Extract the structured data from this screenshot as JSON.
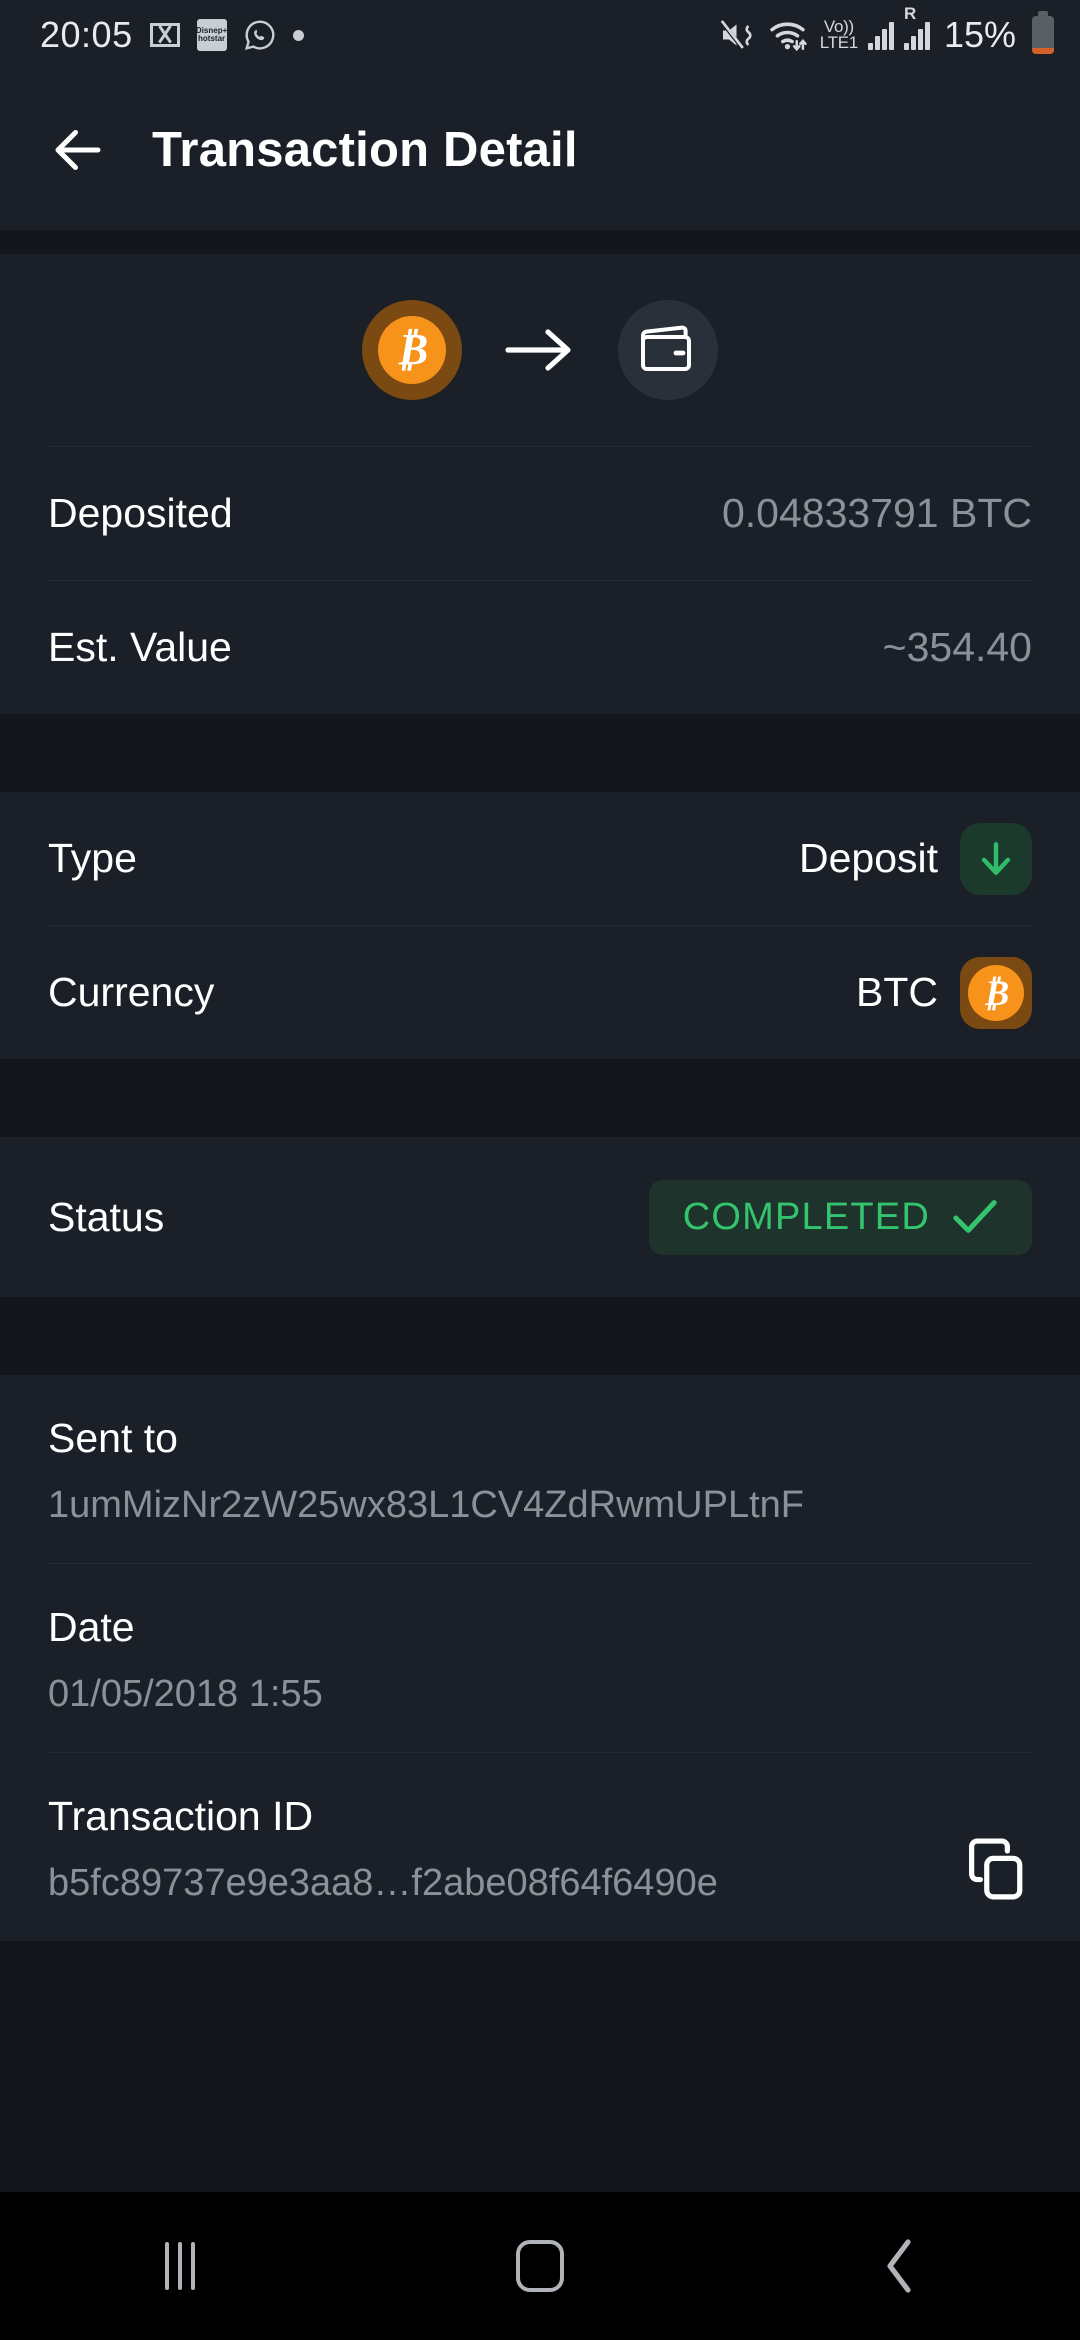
{
  "status_bar": {
    "time": "20:05",
    "icons_left": [
      "gmail-icon",
      "hotstar-icon",
      "whatsapp-icon",
      "dot-icon"
    ],
    "hotstar_line1": "Disnep+",
    "hotstar_line2": "hotstar",
    "icons_right": [
      "mute-vibrate-icon",
      "wifi-icon",
      "volte-icon",
      "signal-icon",
      "roaming-signal-icon"
    ],
    "volte_top": "Vo))",
    "volte_bottom": "LTE1",
    "roaming_letter": "R",
    "battery_percent": "15%"
  },
  "header": {
    "back_label": "back-arrow",
    "title": "Transaction Detail"
  },
  "transfer": {
    "from_icon": "bitcoin-icon",
    "from_symbol": "₿",
    "arrow_icon": "arrow-right-icon",
    "to_icon": "wallet-icon"
  },
  "amounts": [
    {
      "label": "Deposited",
      "value": "0.04833791 BTC"
    },
    {
      "label": "Est. Value",
      "value": "~354.40"
    }
  ],
  "details": [
    {
      "label": "Type",
      "value": "Deposit",
      "badge": "arrow-down-icon"
    },
    {
      "label": "Currency",
      "value": "BTC",
      "badge": "bitcoin-icon"
    }
  ],
  "status": {
    "label": "Status",
    "value": "COMPLETED",
    "icon": "check-icon",
    "color": "#35c46e",
    "background": "#1d332c"
  },
  "info": [
    {
      "label": "Sent to",
      "value": "1umMizNr2zW25wx83L1CV4ZdRwmUPLtnF"
    },
    {
      "label": "Date",
      "value": "01/05/2018 1:55"
    },
    {
      "label": "Transaction ID",
      "value": "b5fc89737e9e3aa8…f2abe08f64f6490e",
      "action": "copy-icon"
    }
  ],
  "nav_bar": {
    "recents_label": "recents-button",
    "home_label": "home-button",
    "back_label": "back-button"
  },
  "theme": {
    "card": "#1b2028",
    "gap": "#13161d",
    "accent_orange": "#f7931a",
    "accent_green": "#35c46e",
    "text_primary": "#ffffff",
    "text_secondary": "#8b9199"
  }
}
